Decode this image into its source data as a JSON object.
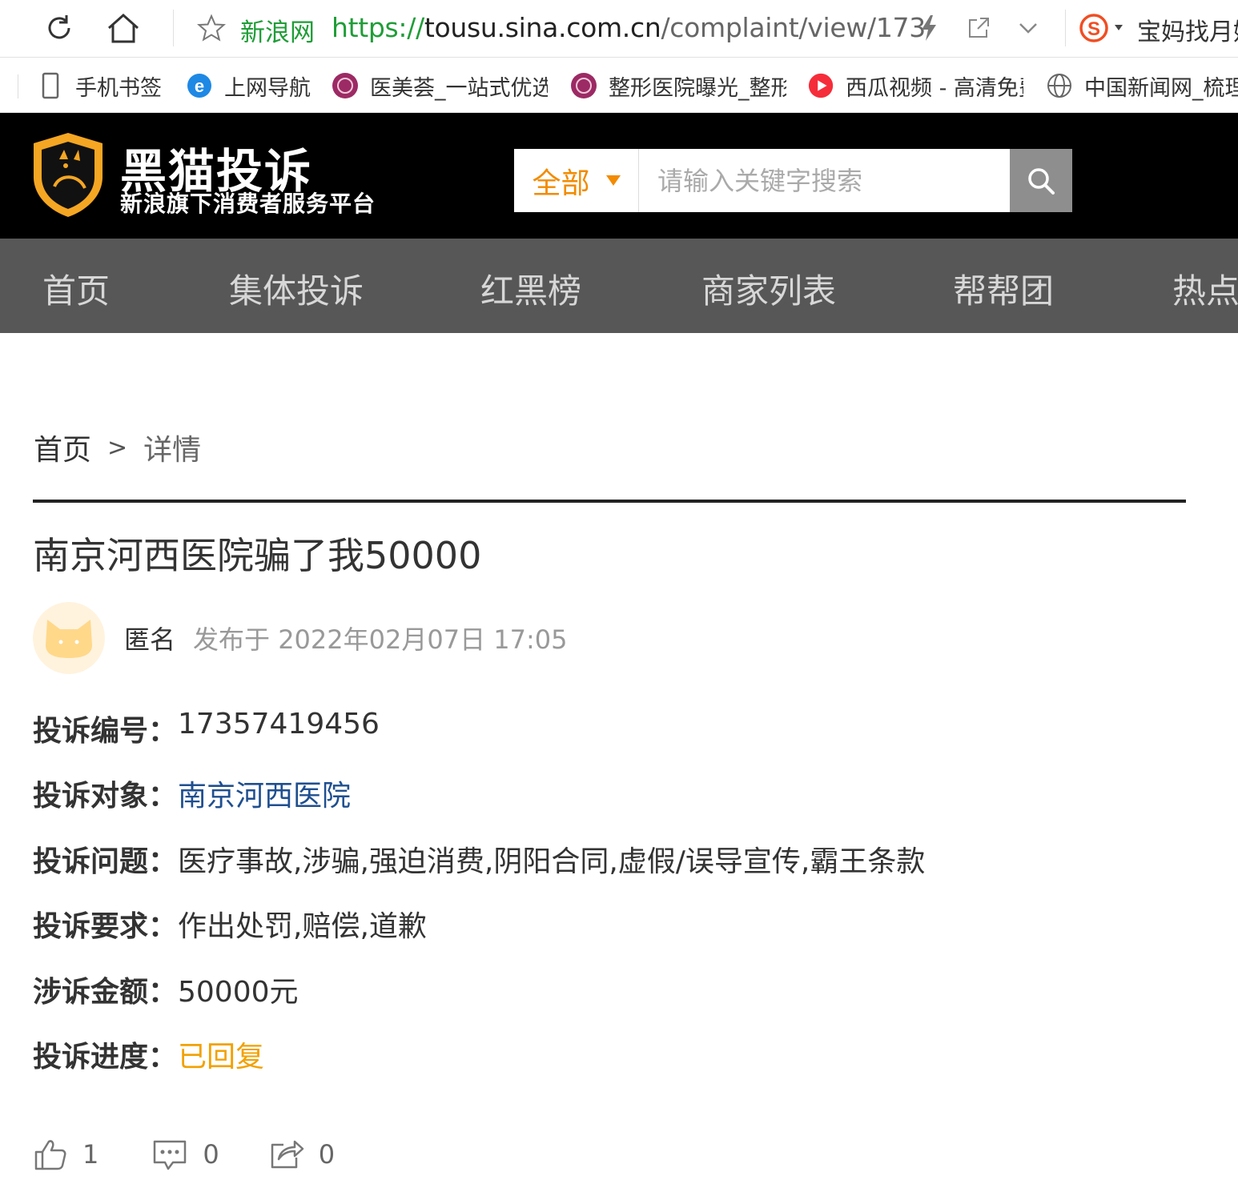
{
  "browser": {
    "site_name": "新浪网",
    "url_scheme": "https://",
    "url_host": "tousu.sina.com.cn",
    "url_path": "/complaint/view/173",
    "extension_label": "宝妈找月嫂"
  },
  "bookmarks": [
    {
      "label": "手机书签",
      "icon": "phone-icon"
    },
    {
      "label": "上网导航",
      "icon": "ie-icon"
    },
    {
      "label": "医美荟_一站式优选",
      "icon": "yimeihui-icon"
    },
    {
      "label": "整形医院曝光_整形",
      "icon": "yimeihui-icon"
    },
    {
      "label": "西瓜视频 - 高清免费",
      "icon": "xigua-icon"
    },
    {
      "label": "中国新闻网_梳理",
      "icon": "globe-icon"
    }
  ],
  "header": {
    "logo_title": "黑猫投诉",
    "logo_subtitle": "新浪旗下消费者服务平台",
    "search_category": "全部",
    "search_placeholder": "请输入关键字搜索"
  },
  "nav": [
    "首页",
    "集体投诉",
    "红黑榜",
    "商家列表",
    "帮帮团",
    "热点"
  ],
  "breadcrumb": {
    "home": "首页",
    "sep": ">",
    "current": "详情"
  },
  "complaint": {
    "title": "南京河西医院骗了我50000",
    "author": "匿名",
    "published": "发布于 2022年02月07日 17:05",
    "fields": [
      {
        "label": "投诉编号：",
        "value": "17357419456"
      },
      {
        "label": "投诉对象：",
        "value": "南京河西医院"
      },
      {
        "label": "投诉问题：",
        "value": "医疗事故,涉骗,强迫消费,阴阳合同,虚假/误导宣传,霸王条款"
      },
      {
        "label": "投诉要求：",
        "value": "作出处罚,赔偿,道歉"
      },
      {
        "label": "涉诉金额：",
        "value": "50000元"
      },
      {
        "label": "投诉进度：",
        "value": "已回复"
      }
    ],
    "likes": "1",
    "comments": "0",
    "shares": "0"
  },
  "colors": {
    "header_bg": "#000000",
    "nav_bg": "#575757",
    "accent_orange": "#f28b00",
    "status_orange": "#f2a100",
    "link_blue": "#1f4f8f",
    "url_green": "#1f9d37"
  }
}
